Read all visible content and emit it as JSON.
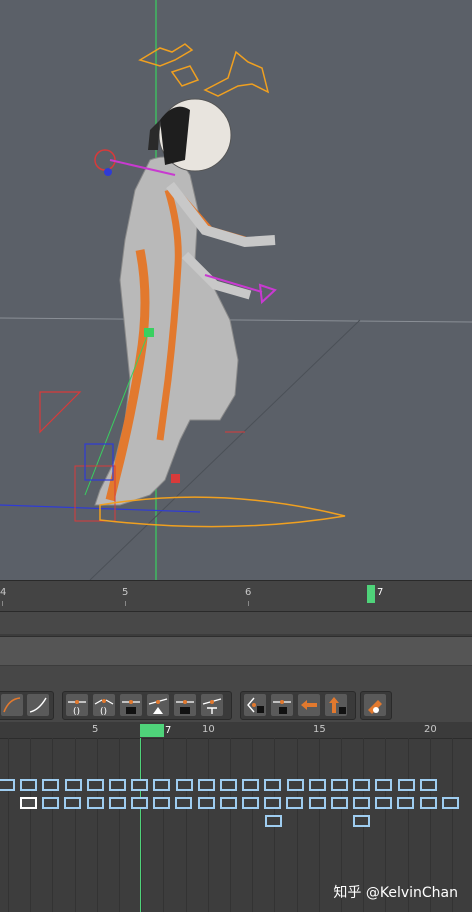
{
  "viewport": {
    "colors": {
      "background": "#5b6068",
      "suit": "#b9b9b9",
      "suit_stripe": "#e2792e",
      "control_orange": "#f0a020",
      "control_red": "#d83a3a",
      "control_blue": "#2f3bd6",
      "control_magenta": "#c83ad0",
      "control_green": "#39d060"
    }
  },
  "time_slider": {
    "ticks": [
      "4",
      "5",
      "6"
    ],
    "current_frame": "7",
    "playhead_color": "#4fd37a"
  },
  "toolbar": {
    "groups": [
      {
        "name": "tangent-curve-buttons",
        "icons": [
          "spline-tangent-icon",
          "linear-tangent-icon"
        ]
      },
      {
        "name": "key-tangent-buttons",
        "icons": [
          "unify-tangents-icon",
          "break-tangents-icon",
          "lock-weight-icon",
          "free-weight-icon",
          "stepped-tangent-icon",
          "plateau-tangent-icon"
        ]
      },
      {
        "name": "lock-buttons",
        "icons": [
          "lock-tangent-icon",
          "lock-key-icon",
          "move-left-icon",
          "move-up-lock-icon"
        ]
      },
      {
        "name": "extra-buttons",
        "icons": [
          "buffer-curve-icon"
        ]
      }
    ]
  },
  "graph_editor": {
    "ruler_ticks": [
      "5",
      "10",
      "15",
      "20"
    ],
    "current_frame": "7",
    "key_colors": {
      "normal": "#9fcdf0",
      "selected": "#ffffff"
    },
    "rows": [
      {
        "row": 1,
        "keys": 20
      },
      {
        "row": 2,
        "keys": 20,
        "selected_index": 0
      },
      {
        "row": 3,
        "keys": 2
      }
    ]
  },
  "watermark": "知乎 @KelvinChan"
}
